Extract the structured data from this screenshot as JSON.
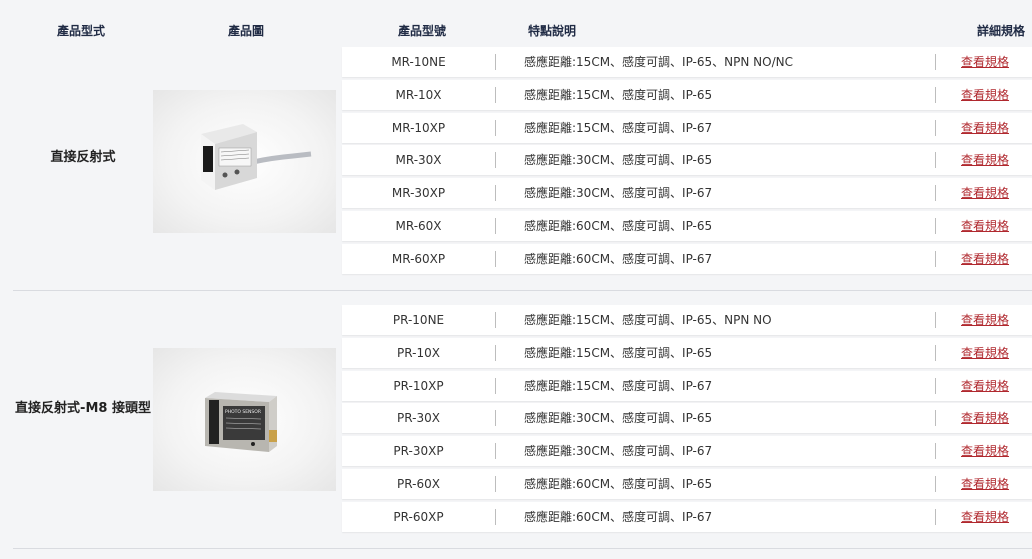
{
  "header": {
    "col_type": "產品型式",
    "col_image": "產品圖",
    "col_model": "產品型號",
    "col_features": "特點說明",
    "col_details": "詳細規格"
  },
  "groups": [
    {
      "type_label": "直接反射式",
      "image_icon": "photo-sensor-product-image",
      "rows": [
        {
          "model": "MR-10NE",
          "features": "感應距離:15CM、感度可調、IP-65、NPN NO/NC",
          "link": "查看規格"
        },
        {
          "model": "MR-10X",
          "features": "感應距離:15CM、感度可調、IP-65",
          "link": "查看規格"
        },
        {
          "model": "MR-10XP",
          "features": "感應距離:15CM、感度可調、IP-67",
          "link": "查看規格"
        },
        {
          "model": "MR-30X",
          "features": "感應距離:30CM、感度可調、IP-65",
          "link": "查看規格"
        },
        {
          "model": "MR-30XP",
          "features": "感應距離:30CM、感度可調、IP-67",
          "link": "查看規格"
        },
        {
          "model": "MR-60X",
          "features": "感應距離:60CM、感度可調、IP-65",
          "link": "查看規格"
        },
        {
          "model": "MR-60XP",
          "features": "感應距離:60CM、感度可調、IP-67",
          "link": "查看規格"
        }
      ]
    },
    {
      "type_label": "直接反射式-M8 接頭型",
      "image_icon": "photo-sensor-m8-product-image",
      "image_text": "PHOTO SENSOR",
      "rows": [
        {
          "model": "PR-10NE",
          "features": "感應距離:15CM、感度可調、IP-65、NPN NO",
          "link": "查看規格"
        },
        {
          "model": "PR-10X",
          "features": "感應距離:15CM、感度可調、IP-65",
          "link": "查看規格"
        },
        {
          "model": "PR-10XP",
          "features": "感應距離:15CM、感度可調、IP-67",
          "link": "查看規格"
        },
        {
          "model": "PR-30X",
          "features": "感應距離:30CM、感度可調、IP-65",
          "link": "查看規格"
        },
        {
          "model": "PR-30XP",
          "features": "感應距離:30CM、感度可調、IP-67",
          "link": "查看規格"
        },
        {
          "model": "PR-60X",
          "features": "感應距離:60CM、感度可調、IP-65",
          "link": "查看規格"
        },
        {
          "model": "PR-60XP",
          "features": "感應距離:60CM、感度可調、IP-67",
          "link": "查看規格"
        }
      ]
    }
  ],
  "colors": {
    "background": "#f4f5f7",
    "header_text": "#1f2a44",
    "link": "#b0282e",
    "row_bg": "#ffffff"
  }
}
